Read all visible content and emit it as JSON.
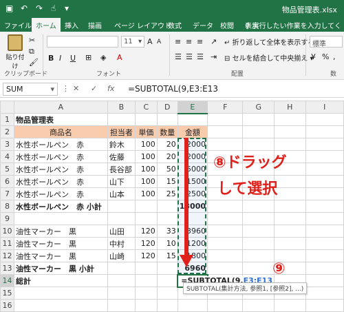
{
  "app": {
    "filename": "物品管理表.xlsx"
  },
  "tabs": [
    "ファイル",
    "ホーム",
    "挿入",
    "描画",
    "ページ レイアウト",
    "数式",
    "データ",
    "校閲",
    "表示"
  ],
  "tell_me": "実行したい作業を入力してく",
  "ribbon": {
    "paste": "貼り付け",
    "clipboard": "クリップボード",
    "font_group": "フォント",
    "align_group": "配置",
    "font_size": "11",
    "wrap_text": "折り返して全体を表示する",
    "merge_center": "セルを結合して中央揃え",
    "number_format": "標準",
    "number_group": "数"
  },
  "formula_bar": {
    "name_box": "SUM",
    "cancel": "✕",
    "enter": "✓",
    "fx": "fx",
    "formula": "=SUBTOTAL(9,E3:E13"
  },
  "columns": [
    "A",
    "B",
    "C",
    "D",
    "E",
    "F",
    "G",
    "H",
    "I"
  ],
  "rows": [
    {
      "n": "1",
      "a": "物品管理表",
      "b": "",
      "c": "",
      "d": "",
      "e": ""
    },
    {
      "n": "2",
      "a": "商品名",
      "b": "担当者",
      "c": "単価",
      "d": "数量",
      "e": "金額"
    },
    {
      "n": "3",
      "a": "水性ボールペン　赤",
      "b": "鈴木",
      "c": "100",
      "d": "20",
      "e": "2000"
    },
    {
      "n": "4",
      "a": "水性ボールペン　赤",
      "b": "佐藤",
      "c": "100",
      "d": "20",
      "e": "2000"
    },
    {
      "n": "5",
      "a": "水性ボールペン　赤",
      "b": "長谷部",
      "c": "100",
      "d": "50",
      "e": "5000"
    },
    {
      "n": "6",
      "a": "水性ボールペン　赤",
      "b": "山下",
      "c": "100",
      "d": "15",
      "e": "1500"
    },
    {
      "n": "7",
      "a": "水性ボールペン　赤",
      "b": "山本",
      "c": "100",
      "d": "25",
      "e": "2500"
    },
    {
      "n": "8",
      "a": "水性ボールペン　赤 小計",
      "b": "",
      "c": "",
      "d": "",
      "e": "13000"
    },
    {
      "n": "9",
      "a": "",
      "b": "",
      "c": "",
      "d": "",
      "e": ""
    },
    {
      "n": "10",
      "a": "油性マーカー　黒",
      "b": "山田",
      "c": "120",
      "d": "33",
      "e": "3960"
    },
    {
      "n": "11",
      "a": "油性マーカー　黒",
      "b": "中村",
      "c": "120",
      "d": "10",
      "e": "1200"
    },
    {
      "n": "12",
      "a": "油性マーカー　黒",
      "b": "山崎",
      "c": "120",
      "d": "15",
      "e": "1800"
    },
    {
      "n": "13",
      "a": "油性マーカー　黒 小計",
      "b": "",
      "c": "",
      "d": "",
      "e": "6960"
    },
    {
      "n": "14",
      "a": "総計",
      "b": "",
      "c": "",
      "d": "",
      "e": "=SUBTOTAL(9,E3:E13"
    },
    {
      "n": "15",
      "a": "",
      "b": "",
      "c": "",
      "d": "",
      "e": ""
    },
    {
      "n": "16",
      "a": "",
      "b": "",
      "c": "",
      "d": "",
      "e": ""
    }
  ],
  "tooltip": "SUBTOTAL(集計方法, 参照1, [参照2], ...)",
  "annotations": {
    "step8_line1": "⑧ドラッグ",
    "step8_line2": "して選択",
    "step9": "⑨"
  },
  "colors": {
    "excel_green": "#217346",
    "header_fill": "#f8cbad",
    "annotation_red": "#e0201a"
  }
}
